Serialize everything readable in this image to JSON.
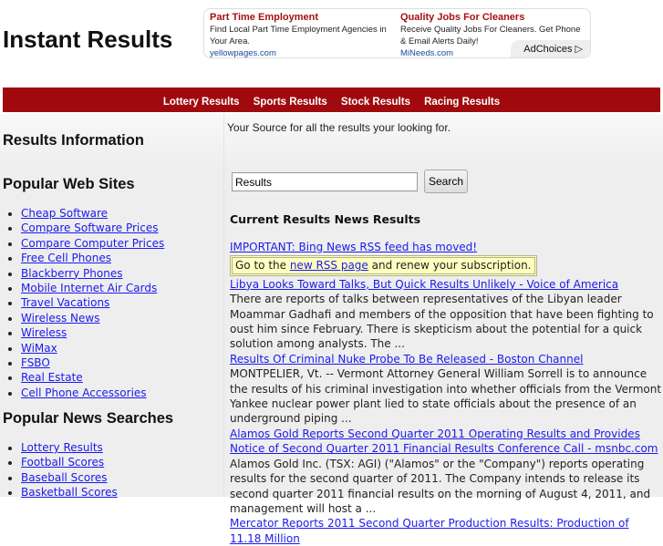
{
  "site_title": "Instant Results",
  "ads": [
    {
      "title": "Part Time Employment",
      "desc": "Find Local Part Time Employment Agencies in Your Area.",
      "url": "yellowpages.com"
    },
    {
      "title": "Quality Jobs For Cleaners",
      "desc": "Receive Quality Jobs For Cleaners. Get Phone & Email Alerts Daily!",
      "url": "MiNeeds.com"
    }
  ],
  "adchoices": "AdChoices ▷",
  "nav": [
    "Lottery Results",
    "Sports Results",
    "Stock Results",
    "Racing Results"
  ],
  "left": {
    "heading": "Results Information",
    "popular_sites_heading": "Popular Web Sites",
    "popular_sites": [
      "Cheap Software",
      "Compare Software Prices",
      "Compare Computer Prices",
      "Free Cell Phones",
      "Blackberry Phones",
      "Mobile Internet Air Cards",
      "Travel Vacations",
      "Wireless News",
      "Wireless",
      "WiMax",
      "FSBO",
      "Real Estate",
      "Cell Phone Accessories"
    ],
    "news_searches_heading": "Popular News Searches",
    "news_searches": [
      "Lottery Results",
      "Football Scores",
      "Baseball Scores",
      "Basketball Scores"
    ]
  },
  "right": {
    "tagline": "Your Source for all the results your looking for.",
    "search_value": "Results",
    "search_button": "Search",
    "news_heading": "Current Results News Results",
    "important": "IMPORTANT: Bing News RSS feed has moved!",
    "notice_pre": "Go to the ",
    "notice_link": "new RSS page",
    "notice_post": " and renew your subscription.",
    "items": [
      {
        "title": "Libya Looks Toward Talks, But Quick Results Unlikely - Voice of America",
        "desc": "There are reports of talks between representatives of the Libyan leader Moammar Gadhafi and members of the opposition that have been fighting to oust him since February. There is skepticism about the potential for a quick solution among analysts. The ..."
      },
      {
        "title": "Results Of Criminal Nuke Probe To Be Released - Boston Channel",
        "desc": "MONTPELIER, Vt. -- Vermont Attorney General William Sorrell is to announce the results of his criminal investigation into whether officials from the Vermont Yankee nuclear power plant lied to state officials about the presence of an underground piping ..."
      },
      {
        "title": "Alamos Gold Reports Second Quarter 2011 Operating Results and Provides Notice of Second Quarter 2011 Financial Results Conference Call - msnbc.com",
        "desc": "Alamos Gold Inc. (TSX: AGI) (\"Alamos\" or the \"Company\") reports operating results for the second quarter of 2011. The Company intends to release its second quarter 2011 financial results on the morning of August 4, 2011, and management will host a ..."
      },
      {
        "title": "Mercator Reports 2011 Second Quarter Production Results: Production of 11.18 Million",
        "desc": ""
      }
    ]
  }
}
